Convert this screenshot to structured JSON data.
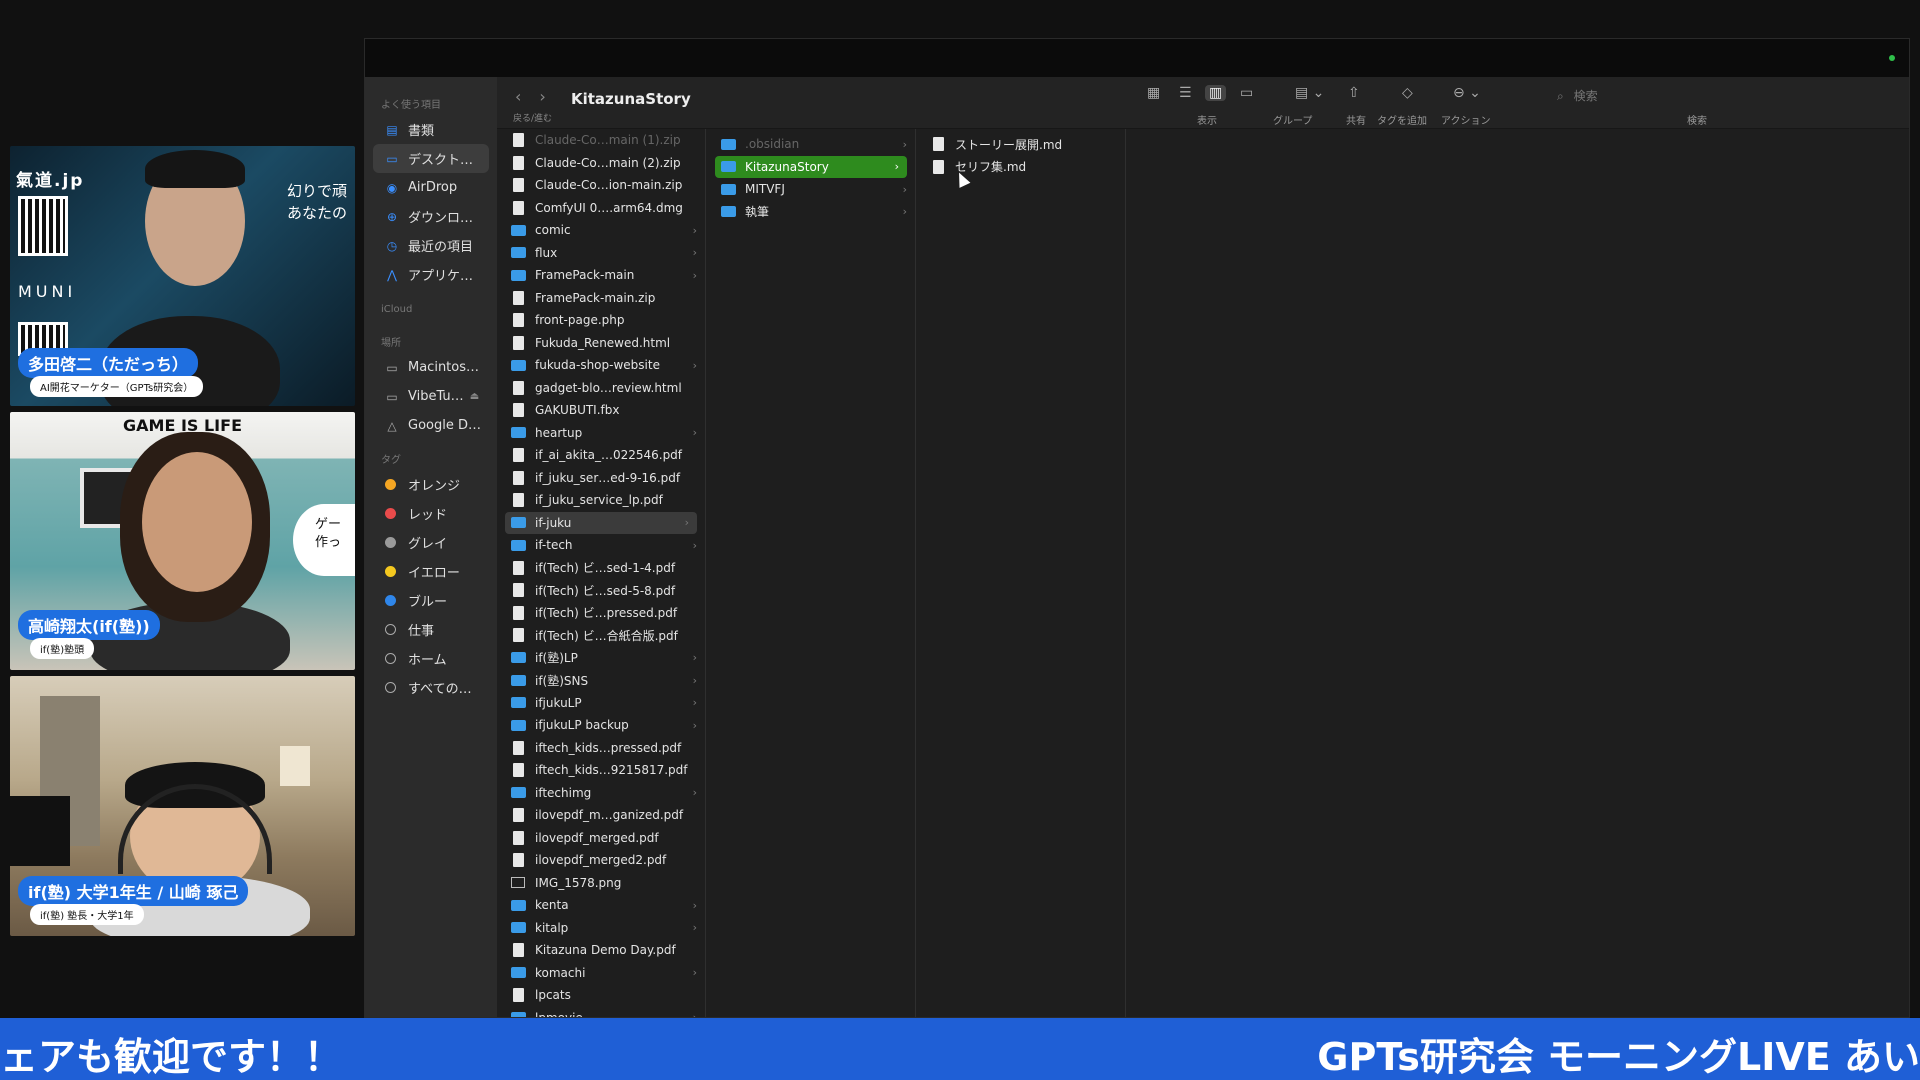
{
  "participants": [
    {
      "brand": "氣道.jp",
      "side_text": [
        "幻りで頑",
        "あなたの"
      ],
      "muni": "MUNI",
      "name": "多田啓二（ただっち）",
      "role": "AI開花マーケター（GPTs研究会）"
    },
    {
      "banner": "GAME IS LIFE",
      "bubble": [
        "ゲー",
        "作っ"
      ],
      "name": "高崎翔太(if(塾))",
      "role": "if(塾)塾頭"
    },
    {
      "name": "if(塾) 大学1年生 / 山崎 琢己",
      "role": "if(塾) 塾長・大学1年"
    }
  ],
  "finder": {
    "title": "KitazunaStory",
    "nav_label": "戻る/進む",
    "toolbar_labels": {
      "view": "表示",
      "group": "グループ",
      "share": "共有",
      "tag": "タグを追加",
      "action": "アクション",
      "search": "検索"
    },
    "search_placeholder": "検索",
    "sidebar": {
      "favorites_header": "よく使う項目",
      "favorites": [
        "書類",
        "デスクト…",
        "AirDrop",
        "ダウンロ…",
        "最近の項目",
        "アプリケ…"
      ],
      "icloud_header": "iCloud",
      "locations_header": "場所",
      "locations": [
        "Macintos…",
        "VibeTu…",
        "Google D…"
      ],
      "tags_header": "タグ",
      "tags": [
        {
          "label": "オレンジ",
          "color": "#f5a623"
        },
        {
          "label": "レッド",
          "color": "#e94b4b"
        },
        {
          "label": "グレイ",
          "color": "#9a9a9a"
        },
        {
          "label": "イエロー",
          "color": "#f4c81f"
        },
        {
          "label": "ブルー",
          "color": "#2f86ea"
        },
        {
          "label": "仕事",
          "color": ""
        },
        {
          "label": "ホーム",
          "color": ""
        },
        {
          "label": "すべての…",
          "color": ""
        }
      ]
    },
    "column1": [
      {
        "name": "Claude-Co…main (1).zip",
        "kind": "file",
        "dim": true
      },
      {
        "name": "Claude-Co…main (2).zip",
        "kind": "file"
      },
      {
        "name": "Claude-Co…ion-main.zip",
        "kind": "file"
      },
      {
        "name": "ComfyUI 0….arm64.dmg",
        "kind": "file"
      },
      {
        "name": "comic",
        "kind": "folder"
      },
      {
        "name": "flux",
        "kind": "folder"
      },
      {
        "name": "FramePack-main",
        "kind": "folder"
      },
      {
        "name": "FramePack-main.zip",
        "kind": "file"
      },
      {
        "name": "front-page.php",
        "kind": "file"
      },
      {
        "name": "Fukuda_Renewed.html",
        "kind": "file"
      },
      {
        "name": "fukuda-shop-website",
        "kind": "folder"
      },
      {
        "name": "gadget-blo…review.html",
        "kind": "file"
      },
      {
        "name": "GAKUBUTI.fbx",
        "kind": "file"
      },
      {
        "name": "heartup",
        "kind": "folder"
      },
      {
        "name": "if_ai_akita_…022546.pdf",
        "kind": "file"
      },
      {
        "name": "if_juku_ser…ed-9-16.pdf",
        "kind": "file"
      },
      {
        "name": "if_juku_service_lp.pdf",
        "kind": "file"
      },
      {
        "name": "if-juku",
        "kind": "folder",
        "selected": true
      },
      {
        "name": "if-tech",
        "kind": "folder"
      },
      {
        "name": "if(Tech) ビ…sed-1-4.pdf",
        "kind": "file"
      },
      {
        "name": "if(Tech) ビ…sed-5-8.pdf",
        "kind": "file"
      },
      {
        "name": "if(Tech) ビ…pressed.pdf",
        "kind": "file"
      },
      {
        "name": "if(Tech) ビ…合紙合版.pdf",
        "kind": "file"
      },
      {
        "name": "if(塾)LP",
        "kind": "folder"
      },
      {
        "name": "if(塾)SNS",
        "kind": "folder"
      },
      {
        "name": "ifjukuLP",
        "kind": "folder"
      },
      {
        "name": "ifjukuLP backup",
        "kind": "folder"
      },
      {
        "name": "iftech_kids…pressed.pdf",
        "kind": "file"
      },
      {
        "name": "iftech_kids…9215817.pdf",
        "kind": "file"
      },
      {
        "name": "iftechimg",
        "kind": "folder"
      },
      {
        "name": "ilovepdf_m…ganized.pdf",
        "kind": "file"
      },
      {
        "name": "ilovepdf_merged.pdf",
        "kind": "file"
      },
      {
        "name": "ilovepdf_merged2.pdf",
        "kind": "file"
      },
      {
        "name": "IMG_1578.png",
        "kind": "image"
      },
      {
        "name": "kenta",
        "kind": "folder"
      },
      {
        "name": "kitalp",
        "kind": "folder"
      },
      {
        "name": "Kitazuna Demo Day.pdf",
        "kind": "file"
      },
      {
        "name": "komachi",
        "kind": "folder"
      },
      {
        "name": "lpcats",
        "kind": "file"
      },
      {
        "name": "lpmovie",
        "kind": "folder"
      }
    ],
    "column2": [
      {
        "name": ".obsidian",
        "kind": "folder",
        "dim": true
      },
      {
        "name": "KitazunaStory",
        "kind": "folder",
        "accent": true
      },
      {
        "name": "MITVFJ",
        "kind": "folder"
      },
      {
        "name": "執筆",
        "kind": "folder"
      }
    ],
    "column3": [
      {
        "name": "ストーリー展開.md",
        "kind": "file"
      },
      {
        "name": "セリフ集.md",
        "kind": "file"
      }
    ]
  },
  "ticker": {
    "left": "ェアも歓迎です！！",
    "right": "GPTs研究会 モーニングLIVE あい"
  },
  "colors": {
    "ticker_bg": "#1f5fd6",
    "selection_accent": "#2e8b1e",
    "folder": "#3a9be8"
  }
}
